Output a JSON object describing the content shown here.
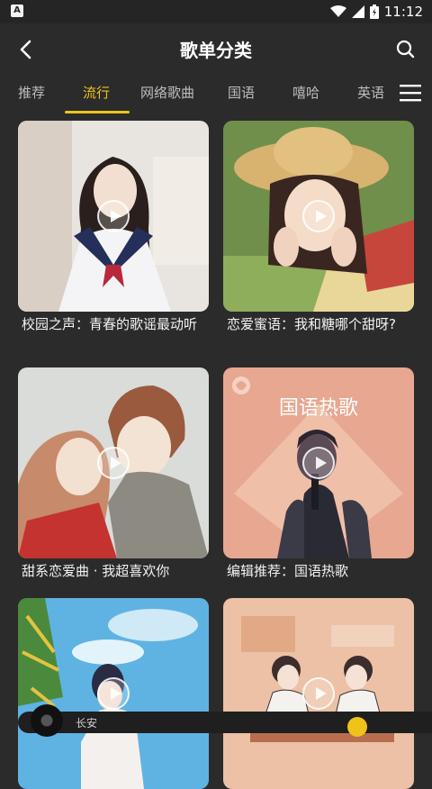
{
  "status_bar": {
    "time": "11:12"
  },
  "header": {
    "title": "歌单分类"
  },
  "tabs": [
    "推荐",
    "流行",
    "网络歌曲",
    "国语",
    "嘻哈",
    "英语"
  ],
  "active_tab": "流行",
  "playlists": [
    {
      "caption": "校园之声：青春的歌谣最动听"
    },
    {
      "caption": "恋爱蜜语：我和糖哪个甜呀?"
    },
    {
      "caption": "甜系恋爱曲 · 我超喜欢你"
    },
    {
      "caption": "编辑推荐：国语热歌",
      "cover_text": "国语热歌"
    },
    {
      "caption": ""
    },
    {
      "caption": ""
    }
  ],
  "player": {
    "text": "长安"
  },
  "colors": {
    "background": "#2b2b2b",
    "accent": "#f0c31a"
  }
}
